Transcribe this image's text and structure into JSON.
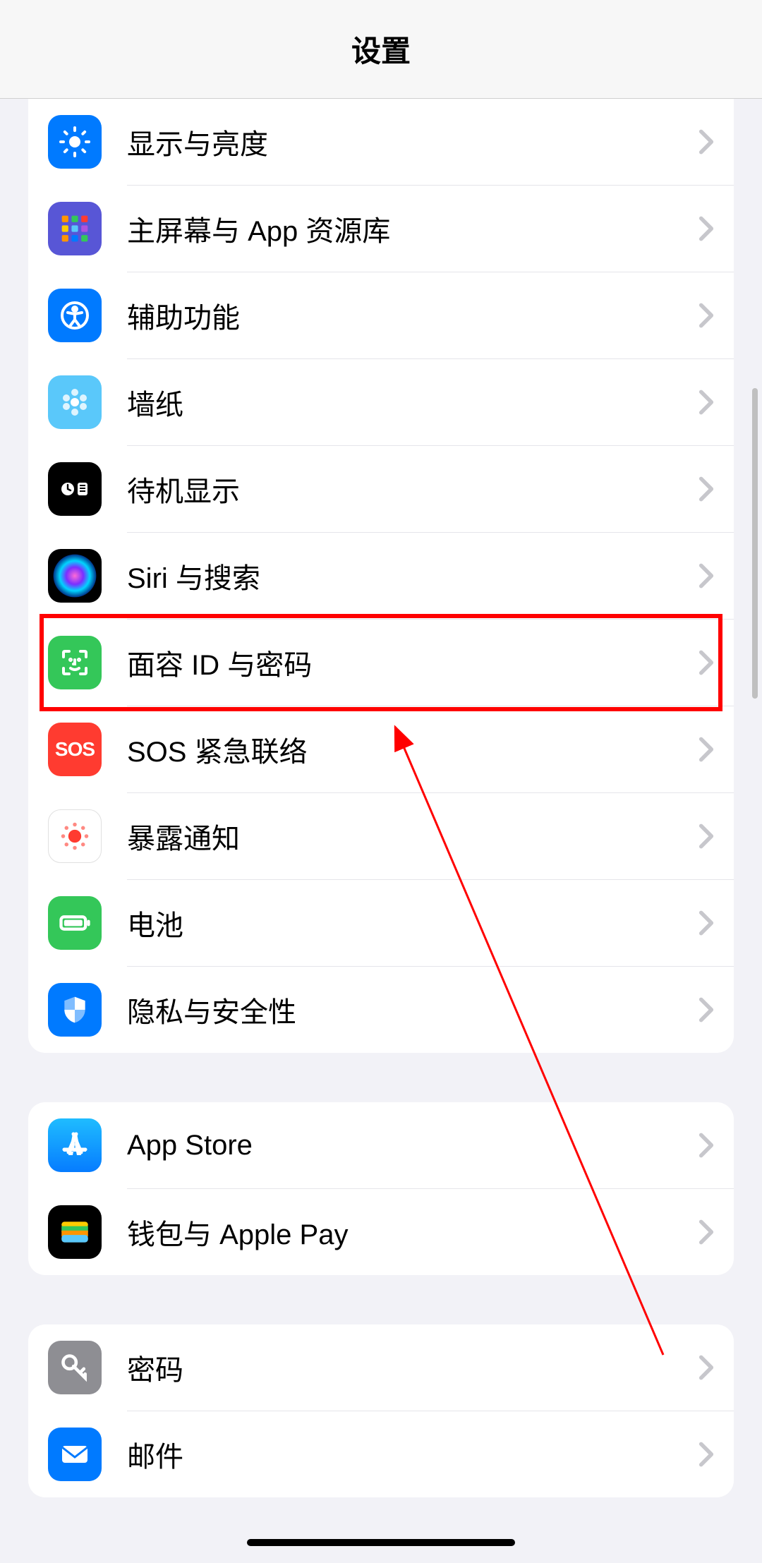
{
  "header": {
    "title": "设置"
  },
  "groups": [
    {
      "items": [
        {
          "id": "display",
          "label": "显示与亮度",
          "icon": "brightness-icon",
          "icon_class": "ic-display"
        },
        {
          "id": "home_screen",
          "label": "主屏幕与 App 资源库",
          "icon": "home-apps-icon",
          "icon_class": "ic-home"
        },
        {
          "id": "accessibility",
          "label": "辅助功能",
          "icon": "accessibility-icon",
          "icon_class": "ic-access"
        },
        {
          "id": "wallpaper",
          "label": "墙纸",
          "icon": "wallpaper-icon",
          "icon_class": "ic-wallpaper"
        },
        {
          "id": "standby",
          "label": "待机显示",
          "icon": "standby-icon",
          "icon_class": "ic-standby"
        },
        {
          "id": "siri",
          "label": "Siri 与搜索",
          "icon": "siri-icon",
          "icon_class": "ic-siri"
        },
        {
          "id": "faceid",
          "label": "面容 ID 与密码",
          "icon": "faceid-icon",
          "icon_class": "ic-faceid",
          "highlighted": true
        },
        {
          "id": "sos",
          "label": "SOS 紧急联络",
          "icon": "sos-icon",
          "icon_class": "ic-sos"
        },
        {
          "id": "exposure",
          "label": "暴露通知",
          "icon": "exposure-icon",
          "icon_class": "ic-exposure"
        },
        {
          "id": "battery",
          "label": "电池",
          "icon": "battery-icon",
          "icon_class": "ic-battery"
        },
        {
          "id": "privacy",
          "label": "隐私与安全性",
          "icon": "privacy-icon",
          "icon_class": "ic-privacy"
        }
      ]
    },
    {
      "items": [
        {
          "id": "appstore",
          "label": "App Store",
          "icon": "appstore-icon",
          "icon_class": "ic-appstore"
        },
        {
          "id": "wallet",
          "label": "钱包与 Apple Pay",
          "icon": "wallet-icon",
          "icon_class": "ic-wallet"
        }
      ]
    },
    {
      "items": [
        {
          "id": "passwords",
          "label": "密码",
          "icon": "key-icon",
          "icon_class": "ic-passwords"
        },
        {
          "id": "mail",
          "label": "邮件",
          "icon": "mail-icon",
          "icon_class": "ic-mail"
        }
      ]
    }
  ],
  "annotations": {
    "highlight_color": "#ff0000"
  }
}
